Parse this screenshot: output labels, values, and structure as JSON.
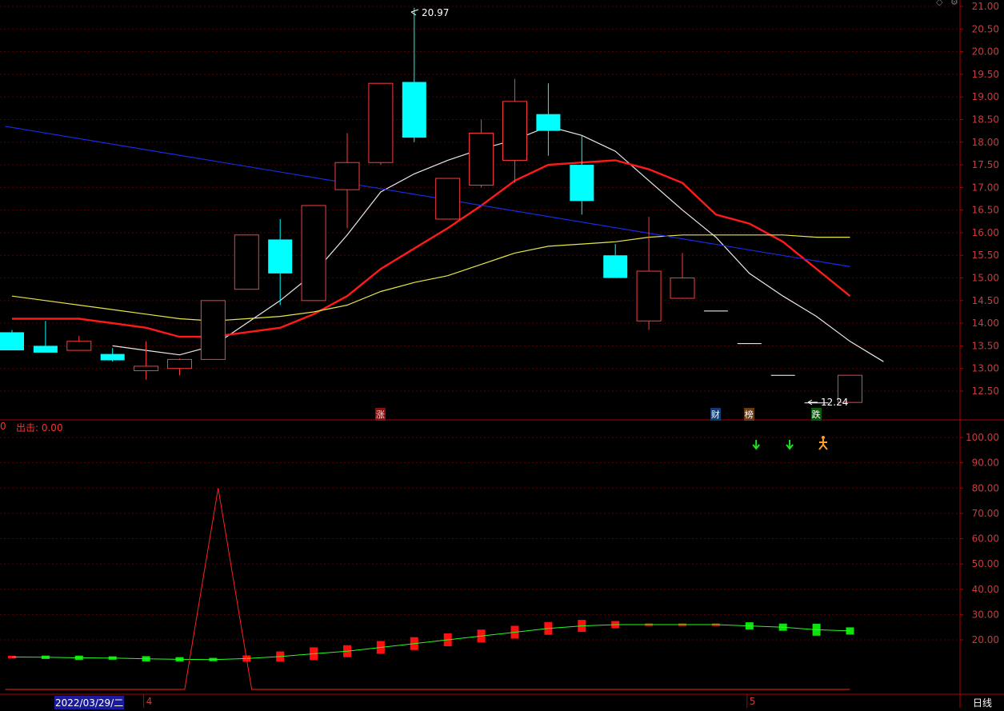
{
  "colors": {
    "background": "#000000",
    "border": "#b00000",
    "axis_text": "#c83c3c",
    "grid": "#5a0000",
    "up_candle": "#ff3b3b",
    "down_candle": "#00ffff",
    "ma_white": "#e8e8e8",
    "ma_red": "#ff1a1a",
    "ma_yellow": "#e6e64a",
    "ma_blue": "#1a2ae6",
    "ind_line_red": "#ff2020",
    "ind_line_green": "#20ff20",
    "flag_text": "#ffffff"
  },
  "header": {
    "exit_label": "出击: 0.00",
    "left_fragment": "0"
  },
  "annotations": {
    "high_label": "20.97",
    "low_label": "12.24"
  },
  "flags": [
    {
      "text": "涨",
      "bar": 11,
      "bg": "#8a1010",
      "fg": "#ffd0d0"
    },
    {
      "text": "财",
      "bar": 21,
      "bg": "#103a70",
      "fg": "#ffffff"
    },
    {
      "text": "榜",
      "bar": 22,
      "bg": "#6a3a10",
      "fg": "#ffffff"
    },
    {
      "text": "跌",
      "bar": 24,
      "bg": "#0a5a0a",
      "fg": "#ffffff"
    }
  ],
  "signals": [
    {
      "type": "down-arrow",
      "bar": 22,
      "color": "#20e020"
    },
    {
      "type": "down-arrow",
      "bar": 23,
      "color": "#20e020"
    },
    {
      "type": "runner",
      "bar": 24,
      "color": "#ffa020"
    }
  ],
  "date_axis": {
    "start_label": "2022/03/29/二",
    "month_labels": [
      {
        "text": "4",
        "bar": 4
      },
      {
        "text": "5",
        "bar": 22
      }
    ],
    "period_label": "日线"
  },
  "chart_data": [
    {
      "type": "candlestick",
      "ylim": [
        12.0,
        21.1
      ],
      "yticks": [
        12.5,
        13.0,
        13.5,
        14.0,
        14.5,
        15.0,
        15.5,
        16.0,
        16.5,
        17.0,
        17.5,
        18.0,
        18.5,
        19.0,
        19.5,
        20.0,
        20.5,
        21.0
      ],
      "candles": [
        {
          "o": 13.8,
          "h": 13.85,
          "l": 13.4,
          "c": 13.4
        },
        {
          "o": 13.5,
          "h": 14.05,
          "l": 13.35,
          "c": 13.35
        },
        {
          "o": 13.4,
          "h": 13.72,
          "l": 13.4,
          "c": 13.6
        },
        {
          "o": 13.32,
          "h": 13.45,
          "l": 13.15,
          "c": 13.18
        },
        {
          "o": 12.95,
          "h": 13.6,
          "l": 12.75,
          "c": 13.05
        },
        {
          "o": 13.0,
          "h": 13.22,
          "l": 12.85,
          "c": 13.2
        },
        {
          "o": 13.2,
          "h": 14.5,
          "l": 13.2,
          "c": 14.5
        },
        {
          "o": 14.75,
          "h": 15.95,
          "l": 14.75,
          "c": 15.95
        },
        {
          "o": 15.85,
          "h": 16.3,
          "l": 14.4,
          "c": 15.1
        },
        {
          "o": 14.5,
          "h": 16.6,
          "l": 14.5,
          "c": 16.6
        },
        {
          "o": 16.95,
          "h": 18.2,
          "l": 16.1,
          "c": 17.55
        },
        {
          "o": 17.55,
          "h": 19.3,
          "l": 17.5,
          "c": 19.3
        },
        {
          "o": 19.33,
          "h": 20.97,
          "l": 18.0,
          "c": 18.1
        },
        {
          "o": 16.3,
          "h": 17.2,
          "l": 16.3,
          "c": 17.2
        },
        {
          "o": 17.05,
          "h": 18.5,
          "l": 17.0,
          "c": 18.2
        },
        {
          "o": 17.6,
          "h": 19.4,
          "l": 17.1,
          "c": 18.9
        },
        {
          "o": 18.62,
          "h": 19.3,
          "l": 17.7,
          "c": 18.25
        },
        {
          "o": 17.5,
          "h": 18.15,
          "l": 16.4,
          "c": 16.7
        },
        {
          "o": 15.5,
          "h": 15.75,
          "l": 15.0,
          "c": 15.0
        },
        {
          "o": 14.05,
          "h": 16.35,
          "l": 13.85,
          "c": 15.15
        },
        {
          "o": 14.55,
          "h": 15.55,
          "l": 14.55,
          "c": 15.0
        },
        {
          "o": 14.27,
          "h": 14.27,
          "l": 14.27,
          "c": 14.27
        },
        {
          "o": 13.55,
          "h": 13.55,
          "l": 13.55,
          "c": 13.55
        },
        {
          "o": 12.85,
          "h": 12.85,
          "l": 12.85,
          "c": 12.85
        },
        {
          "o": 12.24,
          "h": 12.24,
          "l": 12.24,
          "c": 12.24
        },
        {
          "o": 12.25,
          "h": 12.85,
          "l": 12.25,
          "c": 12.85
        }
      ],
      "series": [
        {
          "color_key": "ma_white",
          "width": 1.2,
          "start": 3,
          "values": [
            13.5,
            13.4,
            13.3,
            13.5,
            14.0,
            14.5,
            15.1,
            15.95,
            16.9,
            17.3,
            17.6,
            17.85,
            18.05,
            18.35,
            18.15,
            17.8,
            17.15,
            16.5,
            15.9,
            15.1,
            14.6,
            14.15,
            13.6,
            13.15
          ]
        },
        {
          "color_key": "ma_red",
          "width": 2.4,
          "start": 0,
          "values": [
            14.1,
            14.1,
            14.1,
            14.0,
            13.9,
            13.7,
            13.7,
            13.8,
            13.9,
            14.2,
            14.6,
            15.2,
            15.65,
            16.1,
            16.6,
            17.15,
            17.5,
            17.55,
            17.6,
            17.4,
            17.1,
            16.4,
            16.2,
            15.8,
            15.2,
            14.6
          ]
        },
        {
          "color_key": "ma_yellow",
          "width": 1.2,
          "start": 0,
          "values": [
            14.6,
            14.5,
            14.4,
            14.3,
            14.2,
            14.1,
            14.05,
            14.1,
            14.15,
            14.25,
            14.4,
            14.7,
            14.9,
            15.05,
            15.3,
            15.55,
            15.7,
            15.75,
            15.8,
            15.9,
            15.95,
            15.95,
            15.95,
            15.95,
            15.9,
            15.9
          ]
        },
        {
          "color_key": "ma_blue",
          "width": 1.2,
          "x0": -0.2,
          "x1": 25,
          "v0": 18.35,
          "v1": 15.25
        }
      ]
    },
    {
      "type": "line",
      "ylim": [
        0,
        105
      ],
      "yticks": [
        20.0,
        30.0,
        40.0,
        50.0,
        60.0,
        70.0,
        80.0,
        90.0,
        100.0
      ],
      "spike": {
        "base": 0,
        "x": [
          -0.2,
          5.15,
          6.15,
          7.15,
          25
        ],
        "y": [
          0,
          0,
          80,
          0,
          0
        ]
      },
      "ribbon": [
        13.2,
        13.1,
        12.9,
        12.8,
        12.5,
        12.3,
        12.2,
        12.6,
        13.4,
        14.5,
        15.5,
        17.0,
        18.5,
        20.0,
        21.5,
        23.0,
        24.5,
        25.5,
        26.0,
        26.0,
        26.0,
        26.0,
        25.5,
        25.0,
        24.0,
        23.5
      ]
    }
  ]
}
